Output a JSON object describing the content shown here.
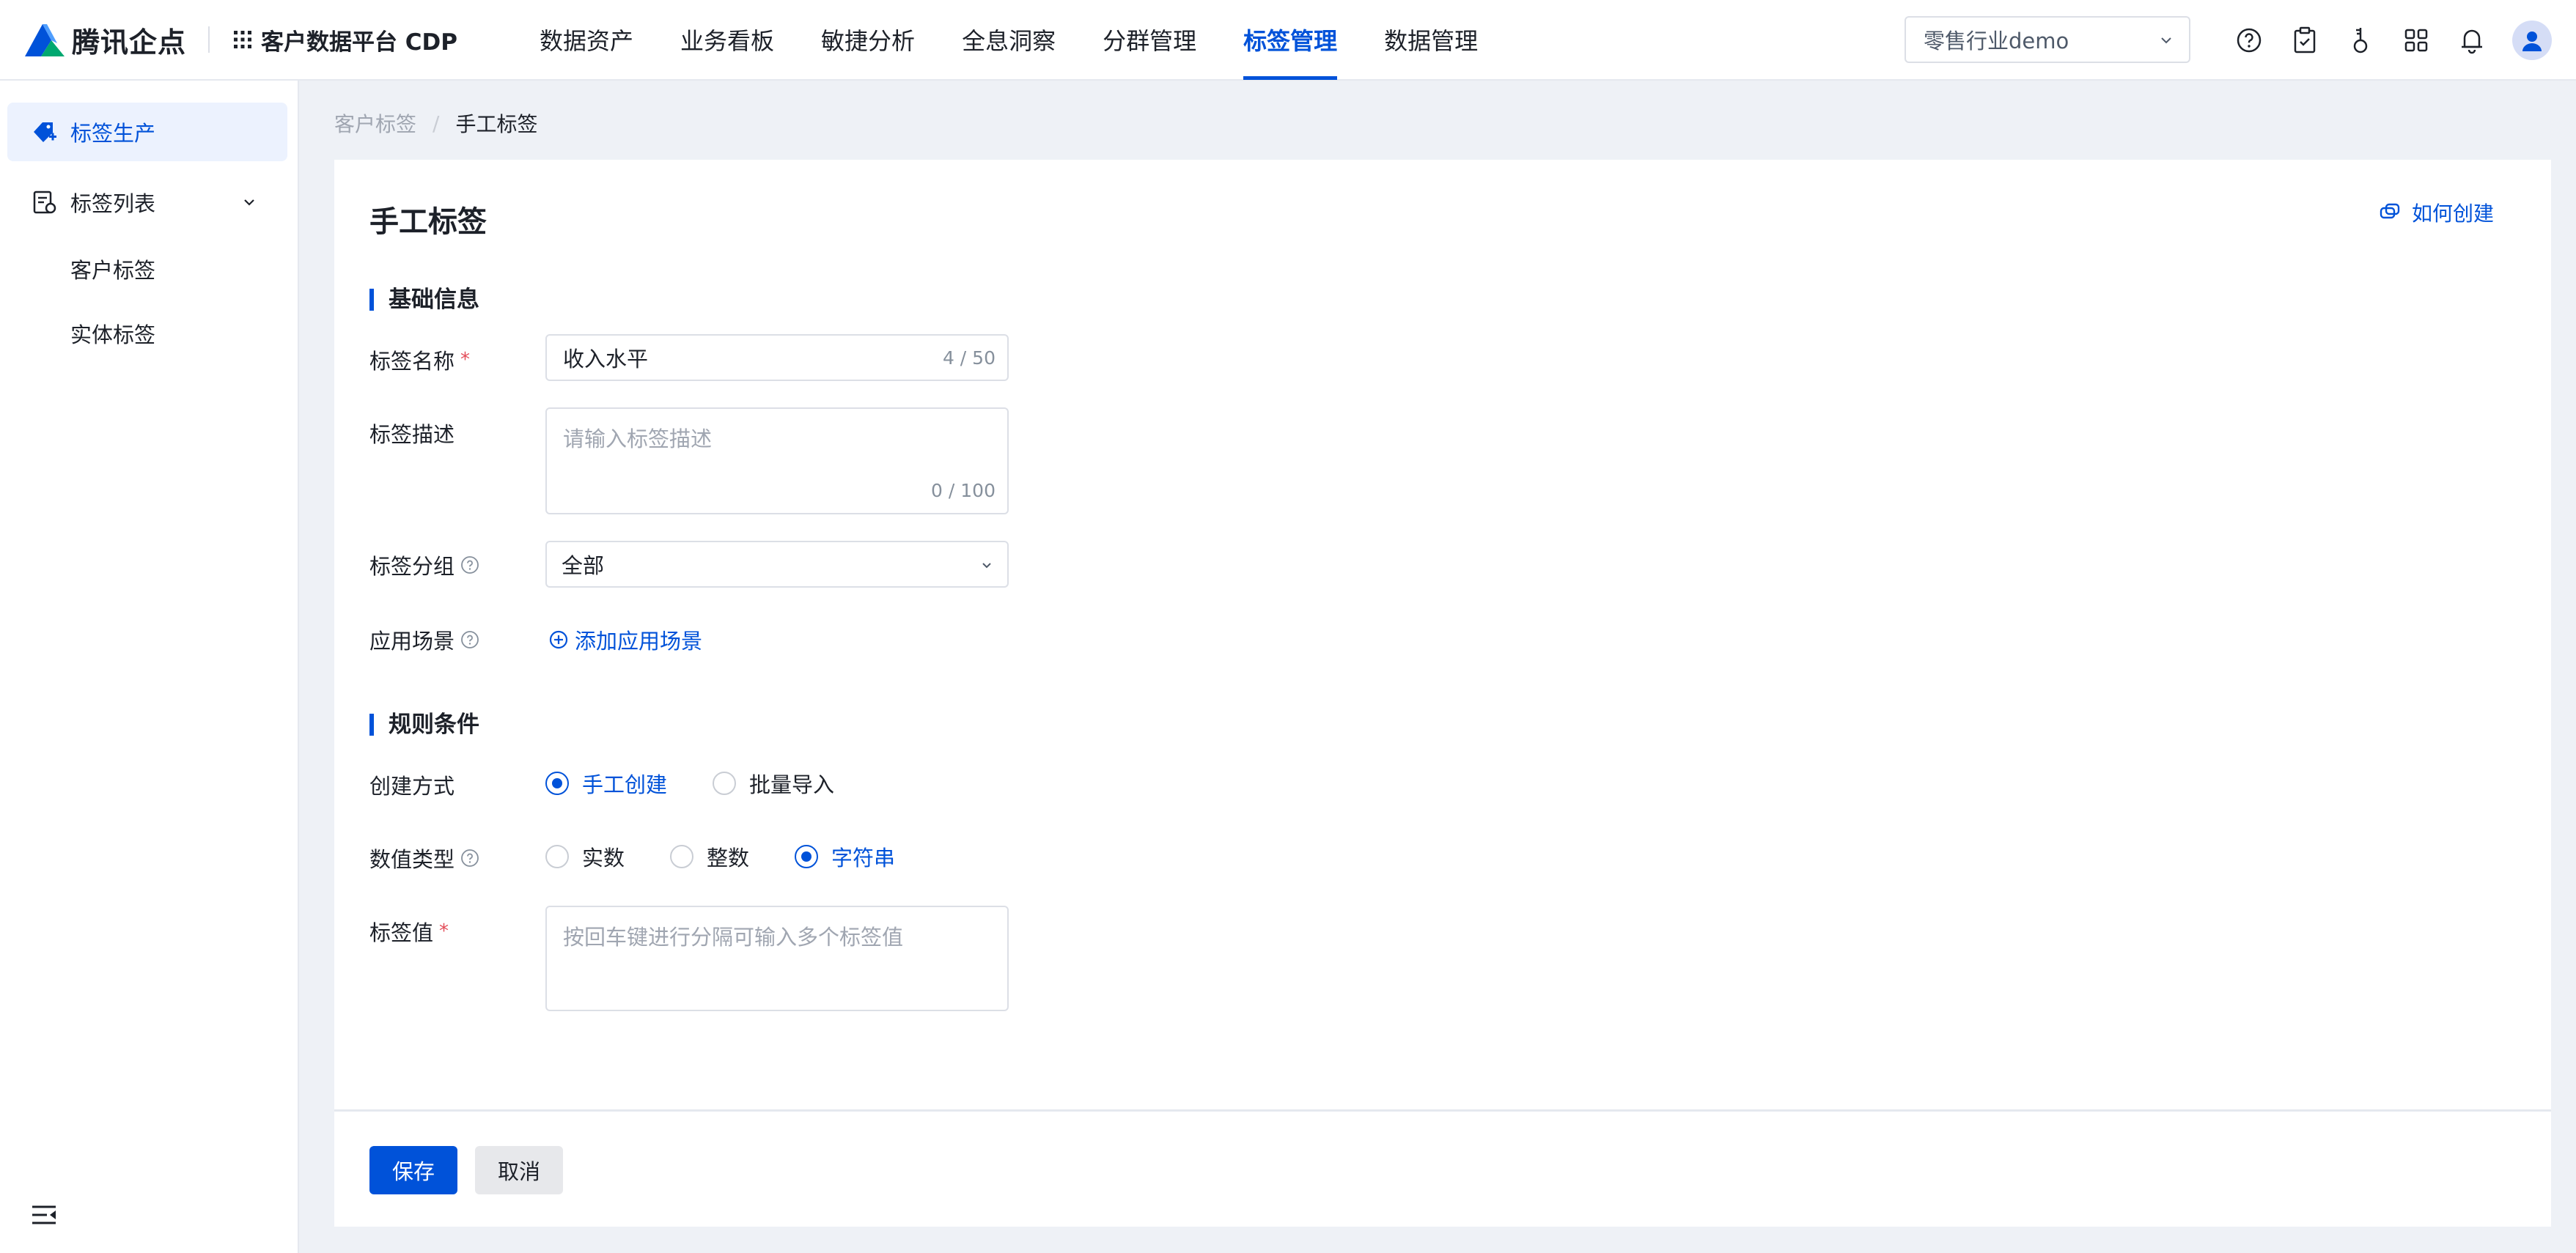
{
  "header": {
    "logo_text": "腾讯企点",
    "product_name": "客户数据平台 CDP",
    "nav": [
      {
        "label": "数据资产",
        "active": false
      },
      {
        "label": "业务看板",
        "active": false
      },
      {
        "label": "敏捷分析",
        "active": false
      },
      {
        "label": "全息洞察",
        "active": false
      },
      {
        "label": "分群管理",
        "active": false
      },
      {
        "label": "标签管理",
        "active": true
      },
      {
        "label": "数据管理",
        "active": false
      }
    ],
    "env_select": "零售行业demo",
    "icons": [
      "help-circle-icon",
      "clipboard-check-icon",
      "key-icon",
      "apps-grid-icon",
      "bell-icon",
      "user-avatar-icon"
    ]
  },
  "sidebar": {
    "items": [
      {
        "label": "标签生产",
        "icon": "tag-add-icon",
        "active": true
      },
      {
        "label": "标签列表",
        "icon": "tag-list-icon",
        "active": false,
        "expanded": true
      }
    ],
    "sub_items": [
      "客户标签",
      "实体标签"
    ],
    "collapse_icon": "menu-fold-icon"
  },
  "breadcrumb": {
    "parent": "客户标签",
    "separator": "/",
    "current": "手工标签"
  },
  "page": {
    "title": "手工标签",
    "how_to_link": "如何创建"
  },
  "basic_info": {
    "section_title": "基础信息",
    "name": {
      "label": "标签名称",
      "required_mark": "*",
      "value": "收入水平",
      "counter": "4 / 50"
    },
    "description": {
      "label": "标签描述",
      "placeholder": "请输入标签描述",
      "counter": "0 / 100"
    },
    "group": {
      "label": "标签分组",
      "value": "全部"
    },
    "scenario": {
      "label": "应用场景",
      "add_link": "添加应用场景"
    }
  },
  "rules": {
    "section_title": "规则条件",
    "create_method": {
      "label": "创建方式",
      "options": [
        {
          "label": "手工创建",
          "checked": true
        },
        {
          "label": "批量导入",
          "checked": false
        }
      ]
    },
    "value_type": {
      "label": "数值类型",
      "options": [
        {
          "label": "实数",
          "checked": false
        },
        {
          "label": "整数",
          "checked": false
        },
        {
          "label": "字符串",
          "checked": true
        }
      ]
    },
    "tag_value": {
      "label": "标签值",
      "required_mark": "*",
      "placeholder": "按回车键进行分隔可输入多个标签值"
    }
  },
  "footer": {
    "save_label": "保存",
    "cancel_label": "取消"
  },
  "colors": {
    "primary": "#0052d9",
    "background": "#eef1f6",
    "required": "#e34d59"
  }
}
